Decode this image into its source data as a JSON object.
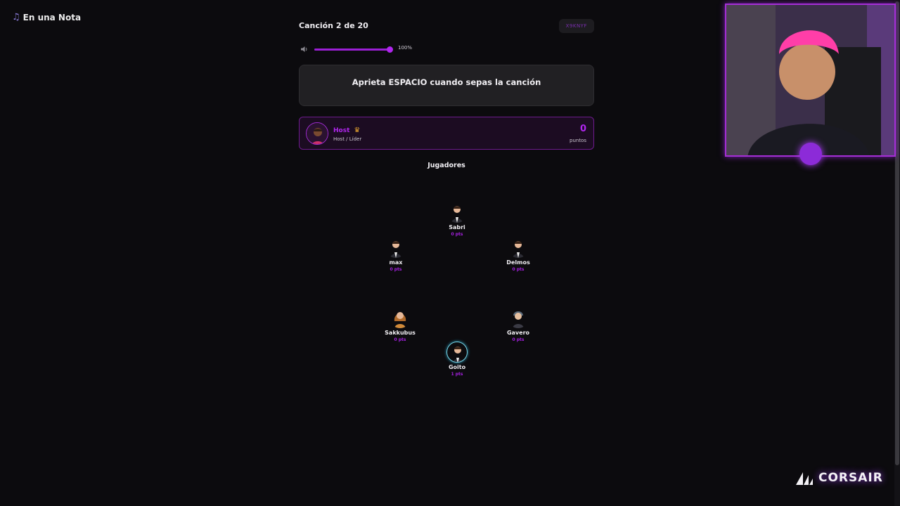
{
  "app": {
    "title": "En una Nota",
    "icon": "music-note-icon"
  },
  "game": {
    "song_progress": "Canción 2 de 20",
    "room_code": "X9KNYF",
    "volume_label": "100%",
    "volume_level": 1.0,
    "prompt": "Aprieta ESPACIO cuando sepas la canción"
  },
  "host": {
    "name": "Host",
    "role": "Host / Líder",
    "points": "0",
    "points_label": "puntos",
    "badge": "crown-icon"
  },
  "players_title": "Jugadores",
  "players": [
    {
      "name": "Sabri",
      "points": "0 pts"
    },
    {
      "name": "max",
      "points": "0 pts"
    },
    {
      "name": "Delmos",
      "points": "0 pts"
    },
    {
      "name": "Sakkubus",
      "points": "0 pts"
    },
    {
      "name": "Gavero",
      "points": "0 pts"
    },
    {
      "name": "Goito",
      "points": "1 pts"
    }
  ],
  "overlay": {
    "sponsor": "CORSAIR"
  },
  "colors": {
    "accent": "#b026ee",
    "background": "#0c0b0e",
    "card": "#212023"
  }
}
